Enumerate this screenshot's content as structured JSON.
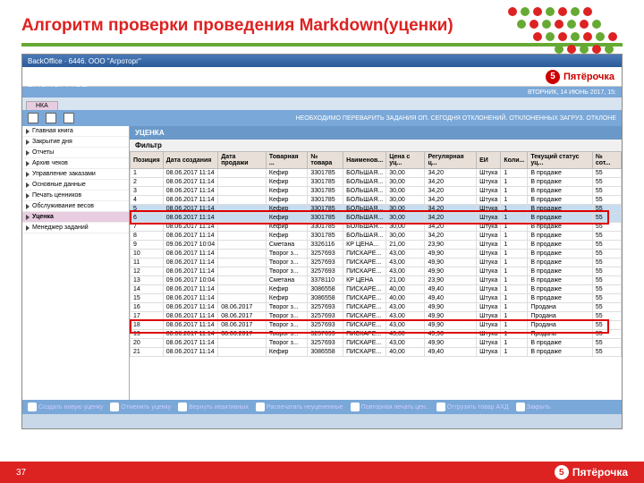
{
  "slide": {
    "title": "Алгоритм проверки проведения Markdown(уценки)",
    "page": "37",
    "brand": "Пятёрочка",
    "brand_num": "5"
  },
  "app": {
    "titlebar": "BackOffice · 6446. ООО \"Агроторг\"",
    "back_label": "BACKOFFICE",
    "date_info": "ВТОРНИК, 14 ИЮНЬ 2017, 15:",
    "tab": "НКА",
    "toolbar_msg": "НЕОБХОДИМО ПЕРЕВАРИТЬ ЗАДАНИЯ ОП. СЕГОДНЯ ОТКЛОНЕНИЙ. ОТКЛОНЕННЫХ ЗАГРУЗ. ОТКЛОНЕ",
    "main_header": "УЦЕНКА",
    "filter": "Фильтр"
  },
  "sidebar": {
    "items": [
      {
        "label": "Главная книга"
      },
      {
        "label": "Закрытие дня"
      },
      {
        "label": "Отчеты"
      },
      {
        "label": "Архив чеков"
      },
      {
        "label": "Управление заказами"
      },
      {
        "label": "Основные данные"
      },
      {
        "label": "Печать ценников"
      },
      {
        "label": "Обслуживание весов"
      },
      {
        "label": "Уценка"
      },
      {
        "label": "Менеджер заданий"
      }
    ]
  },
  "columns": [
    "Позиция",
    "Дата создания",
    "Дата продажи",
    "Товарная ...",
    "№ товара",
    "Наименов...",
    "Цена с уц...",
    "Регулярная ц...",
    "ЕИ",
    "Коли...",
    "Текущий статус уц...",
    "№ сот..."
  ],
  "rows": [
    {
      "c": [
        "1",
        "08.06.2017 11:14",
        "",
        "Кефир",
        "3301785",
        "БОЛЬШАЯ...",
        "30,00",
        "34,20",
        "Штука",
        "1",
        "В продаже",
        "55"
      ]
    },
    {
      "c": [
        "2",
        "08.06.2017 11:14",
        "",
        "Кефир",
        "3301785",
        "БОЛЬШАЯ...",
        "30,00",
        "34,20",
        "Штука",
        "1",
        "В продаже",
        "55"
      ]
    },
    {
      "c": [
        "3",
        "08.06.2017 11:14",
        "",
        "Кефир",
        "3301785",
        "БОЛЬШАЯ...",
        "30,00",
        "34,20",
        "Штука",
        "1",
        "В продаже",
        "55"
      ]
    },
    {
      "c": [
        "4",
        "08.06.2017 11:14",
        "",
        "Кефир",
        "3301785",
        "БОЛЬШАЯ...",
        "30,00",
        "34,20",
        "Штука",
        "1",
        "В продаже",
        "55"
      ]
    },
    {
      "c": [
        "5",
        "08.06.2017 11:14",
        "",
        "Кефир",
        "3301785",
        "БОЛЬШАЯ...",
        "30,00",
        "34,20",
        "Штука",
        "1",
        "В продаже",
        "55"
      ],
      "hl": true
    },
    {
      "c": [
        "6",
        "08.06.2017 11:14",
        "",
        "Кефир",
        "3301785",
        "БОЛЬШАЯ...",
        "30,00",
        "34,20",
        "Штука",
        "1",
        "В продаже",
        "55"
      ],
      "hl": true
    },
    {
      "c": [
        "7",
        "08.06.2017 11:14",
        "",
        "Кефир",
        "3301785",
        "БОЛЬШАЯ...",
        "30,00",
        "34,20",
        "Штука",
        "1",
        "В продаже",
        "55"
      ]
    },
    {
      "c": [
        "8",
        "08.06.2017 11:14",
        "",
        "Кефир",
        "3301785",
        "БОЛЬШАЯ...",
        "30,00",
        "34,20",
        "Штука",
        "1",
        "В продаже",
        "55"
      ]
    },
    {
      "c": [
        "9",
        "09.06.2017 10:04",
        "",
        "Сметана",
        "3326116",
        "КР ЦЕНА...",
        "21,00",
        "23,90",
        "Штука",
        "1",
        "В продаже",
        "55"
      ]
    },
    {
      "c": [
        "10",
        "08.06.2017 11:14",
        "",
        "Творог з...",
        "3257693",
        "ПИСКАРЕ...",
        "43,00",
        "49,90",
        "Штука",
        "1",
        "В продаже",
        "55"
      ]
    },
    {
      "c": [
        "11",
        "08.06.2017 11:14",
        "",
        "Творог з...",
        "3257693",
        "ПИСКАРЕ...",
        "43,00",
        "49,90",
        "Штука",
        "1",
        "В продаже",
        "55"
      ]
    },
    {
      "c": [
        "12",
        "08.06.2017 11:14",
        "",
        "Творог з...",
        "3257693",
        "ПИСКАРЕ...",
        "43,00",
        "49,90",
        "Штука",
        "1",
        "В продаже",
        "55"
      ]
    },
    {
      "c": [
        "13",
        "09.06.2017 10:04",
        "",
        "Сметана",
        "3378110",
        "КР ЦЕНА",
        "21,00",
        "23,90",
        "Штука",
        "1",
        "В продаже",
        "55"
      ]
    },
    {
      "c": [
        "14",
        "08.06.2017 11:14",
        "",
        "Кефир",
        "3086558",
        "ПИСКАРЕ...",
        "40,00",
        "49,40",
        "Штука",
        "1",
        "В продаже",
        "55"
      ]
    },
    {
      "c": [
        "15",
        "08.06.2017 11:14",
        "",
        "Кефир",
        "3086558",
        "ПИСКАРЕ...",
        "40,00",
        "49,40",
        "Штука",
        "1",
        "В продаже",
        "55"
      ]
    },
    {
      "c": [
        "16",
        "08.06.2017 11:14",
        "08.06.2017",
        "Творог з...",
        "3257693",
        "ПИСКАРЕ...",
        "43,00",
        "49,90",
        "Штука",
        "1",
        "Продана",
        "55"
      ]
    },
    {
      "c": [
        "17",
        "08.06.2017 11:14",
        "08.06.2017",
        "Творог з...",
        "3257693",
        "ПИСКАРЕ...",
        "43,00",
        "49,90",
        "Штука",
        "1",
        "Продана",
        "55"
      ]
    },
    {
      "c": [
        "18",
        "08.06.2017 11:14",
        "08.06.2017",
        "Творог з...",
        "3257693",
        "ПИСКАРЕ...",
        "43,00",
        "49,90",
        "Штука",
        "1",
        "Продана",
        "55"
      ]
    },
    {
      "c": [
        "19",
        "08.06.2017 11:14",
        "08.06.2017",
        "Творог з...",
        "3257693",
        "ПИСКАРЕ...",
        "43,00",
        "49,90",
        "Штука",
        "1",
        "Продана",
        "55"
      ]
    },
    {
      "c": [
        "20",
        "08.06.2017 11:14",
        "",
        "Творог з...",
        "3257693",
        "ПИСКАРЕ...",
        "43,00",
        "49,90",
        "Штука",
        "1",
        "В продаже",
        "55"
      ]
    },
    {
      "c": [
        "21",
        "08.06.2017 11:14",
        "",
        "Кефир",
        "3086558",
        "ПИСКАРЕ...",
        "40,00",
        "49,40",
        "Штука",
        "1",
        "В продаже",
        "55"
      ]
    }
  ],
  "footer_actions": [
    "Создать новую уценку",
    "Отменить уценку",
    "Вернуть неактивных",
    "Распечатать неуцененные",
    "Повторная печать цен..",
    "Отгрузить товар АХД",
    "Закрыть"
  ]
}
